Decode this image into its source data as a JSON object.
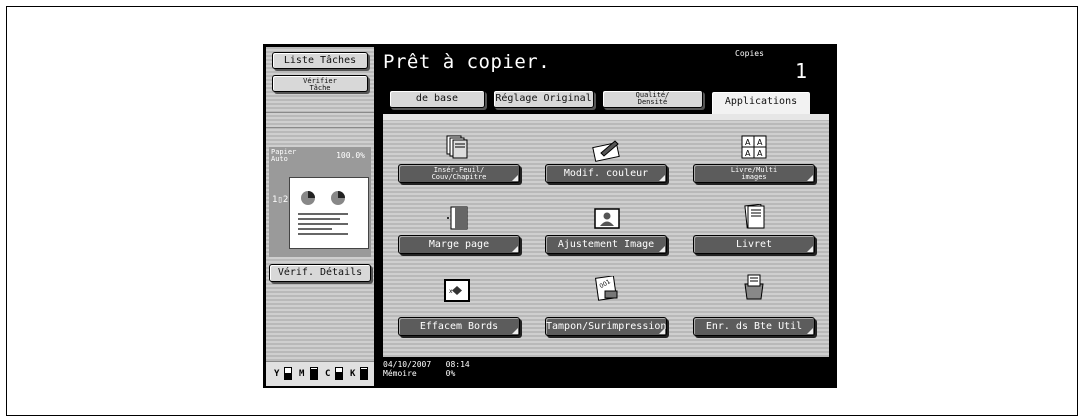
{
  "left": {
    "job_list": "Liste Tâches",
    "check_job": "Vérifier\nTâche",
    "paper": "Papier\nAuto",
    "zoom": "100.0%",
    "nup": "1▯2",
    "check_details": "Vérif. Détails",
    "toner": [
      "Y",
      "M",
      "C",
      "K"
    ]
  },
  "header": {
    "title": "Prêt à copier.",
    "copies_label": "Copies",
    "copies_value": "1"
  },
  "tabs": [
    {
      "label": "de base"
    },
    {
      "label": "Réglage Original"
    },
    {
      "label": "Qualité/\nDensité"
    },
    {
      "label": "Applications"
    }
  ],
  "apps": [
    {
      "label": "Insér.Feuil/\nCouv/Chapitre",
      "icon": "insert-sheet-icon"
    },
    {
      "label": "Modif. couleur",
      "icon": "color-change-icon"
    },
    {
      "label": "Livre/Multi\nimages",
      "icon": "multi-image-icon"
    },
    {
      "label": "Marge page",
      "icon": "page-margin-icon"
    },
    {
      "label": "Ajustement Image",
      "icon": "image-adjust-icon"
    },
    {
      "label": "Livret",
      "icon": "booklet-icon"
    },
    {
      "label": "Effacem Bords",
      "icon": "edge-erase-icon"
    },
    {
      "label": "Tampon/Surimpression",
      "icon": "stamp-icon"
    },
    {
      "label": "Enr. ds Bte Util",
      "icon": "save-box-icon"
    }
  ],
  "status": {
    "date": "04/10/2007",
    "time": "08:14",
    "memory_label": "Mémoire",
    "memory_value": "0%"
  }
}
